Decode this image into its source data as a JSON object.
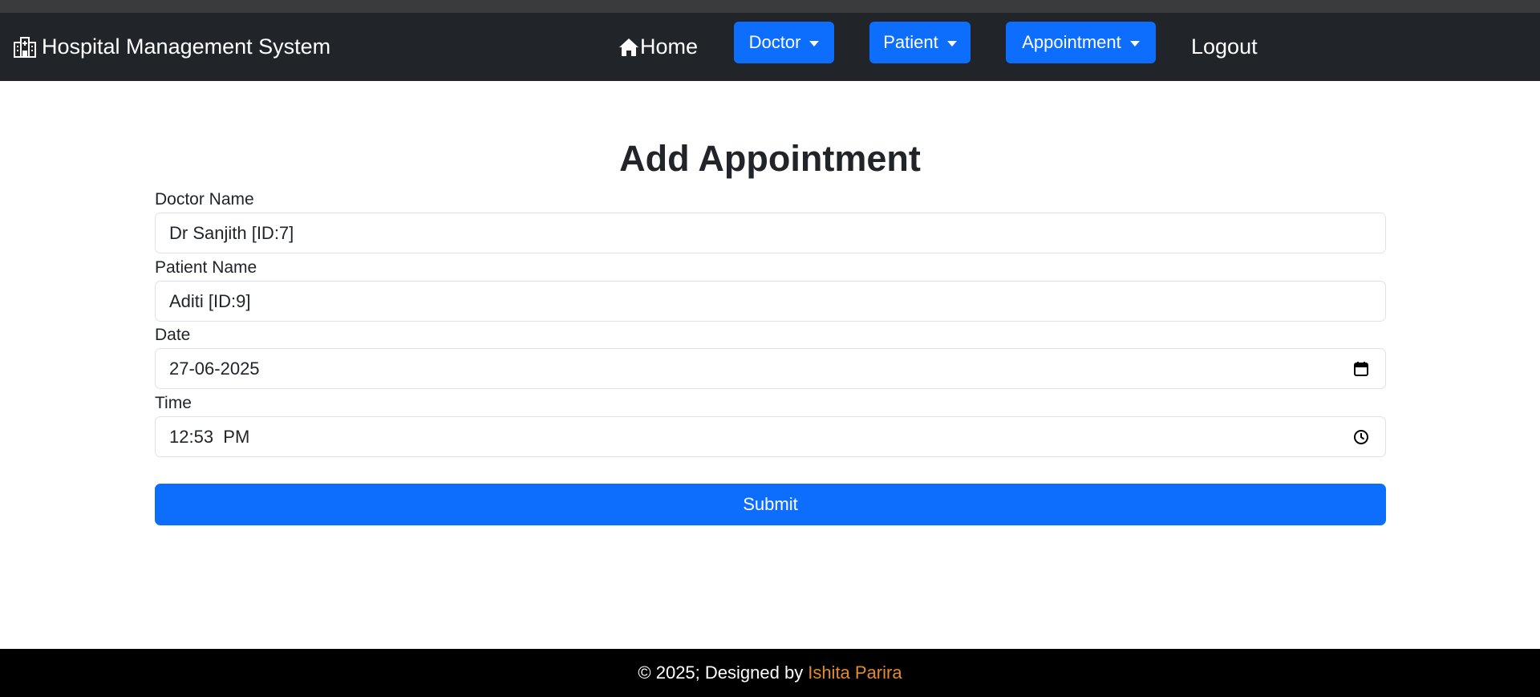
{
  "navbar": {
    "brand_icon": "hospital-icon",
    "brand": "Hospital Management System",
    "home_icon": "house-icon",
    "home": "Home",
    "menus": [
      {
        "label": "Doctor"
      },
      {
        "label": "Patient"
      },
      {
        "label": "Appointment"
      }
    ],
    "logout": "Logout"
  },
  "form": {
    "title": "Add Appointment",
    "doctor": {
      "label": "Doctor Name",
      "value": "Dr Sanjith [ID:7]"
    },
    "patient": {
      "label": "Patient Name",
      "value": "Aditi [ID:9]"
    },
    "date": {
      "label": "Date",
      "value": "27-06-2025",
      "icon": "calendar-icon"
    },
    "time": {
      "label": "Time",
      "value": "12:53  PM",
      "icon": "clock-icon"
    },
    "submit": "Submit"
  },
  "footer": {
    "text": "© 2025; Designed by",
    "author": "Ishita Parira"
  },
  "colors": {
    "navbar_bg": "#212529",
    "primary": "#0d6efd",
    "footer_bg": "#000000",
    "author_link": "#e38b2c"
  }
}
